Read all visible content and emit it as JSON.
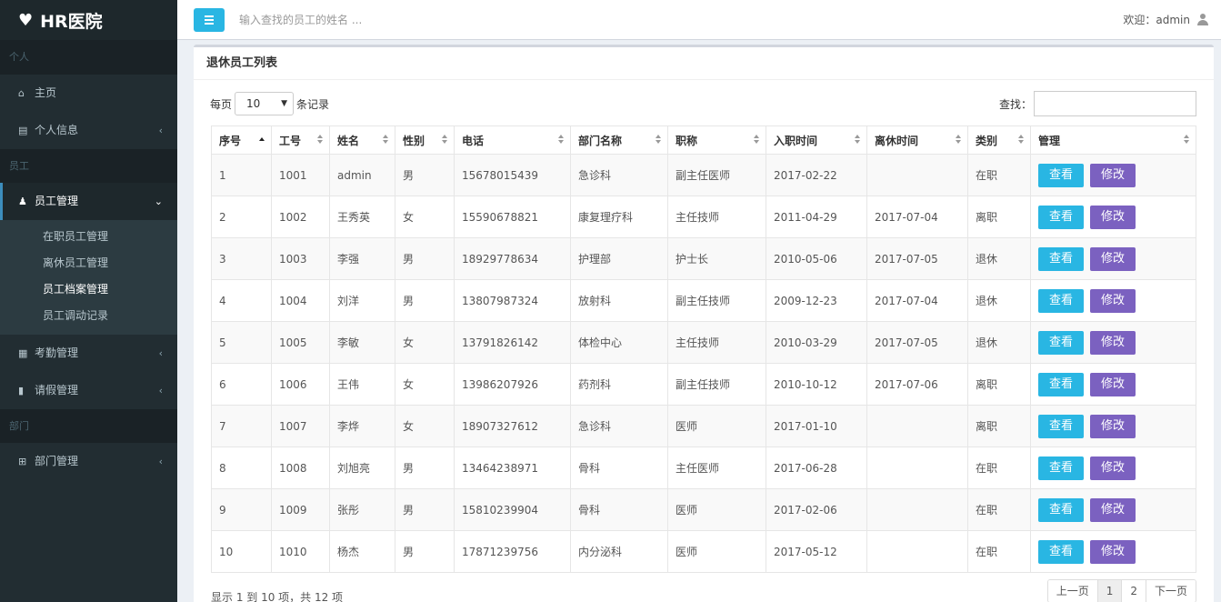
{
  "app": {
    "name": "HR医院"
  },
  "sidebar": {
    "sections": [
      "个人",
      "员工",
      "部门"
    ],
    "home": "主页",
    "profile": "个人信息",
    "emp_manage": "员工管理",
    "sub": [
      "在职员工管理",
      "离休员工管理",
      "员工档案管理",
      "员工调动记录"
    ],
    "attendance": "考勤管理",
    "leave": "请假管理",
    "dept": "部门管理"
  },
  "topbar": {
    "search_placeholder": "输入查找的员工的姓名 ...",
    "welcome": "欢迎：admin"
  },
  "box": {
    "title": "退休员工列表"
  },
  "controls": {
    "per_page": "每页",
    "records": "条记录",
    "page_size": "10",
    "search_label": "查找："
  },
  "table": {
    "headers": [
      "序号",
      "工号",
      "姓名",
      "性别",
      "电话",
      "部门名称",
      "职称",
      "入职时间",
      "离休时间",
      "类别",
      "管理"
    ],
    "view_label": "查看",
    "edit_label": "修改",
    "rows": [
      [
        "1",
        "1001",
        "admin",
        "男",
        "15678015439",
        "急诊科",
        "副主任医师",
        "2017-02-22",
        "",
        "在职"
      ],
      [
        "2",
        "1002",
        "王秀英",
        "女",
        "15590678821",
        "康复理疗科",
        "主任技师",
        "2011-04-29",
        "2017-07-04",
        "离职"
      ],
      [
        "3",
        "1003",
        "李强",
        "男",
        "18929778634",
        "护理部",
        "护士长",
        "2010-05-06",
        "2017-07-05",
        "退休"
      ],
      [
        "4",
        "1004",
        "刘洋",
        "男",
        "13807987324",
        "放射科",
        "副主任技师",
        "2009-12-23",
        "2017-07-04",
        "退休"
      ],
      [
        "5",
        "1005",
        "李敏",
        "女",
        "13791826142",
        "体检中心",
        "主任技师",
        "2010-03-29",
        "2017-07-05",
        "退休"
      ],
      [
        "6",
        "1006",
        "王伟",
        "女",
        "13986207926",
        "药剂科",
        "副主任技师",
        "2010-10-12",
        "2017-07-06",
        "离职"
      ],
      [
        "7",
        "1007",
        "李烨",
        "女",
        "18907327612",
        "急诊科",
        "医师",
        "2017-01-10",
        "",
        "离职"
      ],
      [
        "8",
        "1008",
        "刘旭亮",
        "男",
        "13464238971",
        "骨科",
        "主任医师",
        "2017-06-28",
        "",
        "在职"
      ],
      [
        "9",
        "1009",
        "张彤",
        "男",
        "15810239904",
        "骨科",
        "医师",
        "2017-02-06",
        "",
        "在职"
      ],
      [
        "10",
        "1010",
        "杨杰",
        "男",
        "17871239756",
        "内分泌科",
        "医师",
        "2017-05-12",
        "",
        "在职"
      ]
    ]
  },
  "footer": {
    "info": "显示 1 到 10 项，共 12 项",
    "prev": "上一页",
    "pages": [
      "1",
      "2"
    ],
    "next": "下一页"
  }
}
